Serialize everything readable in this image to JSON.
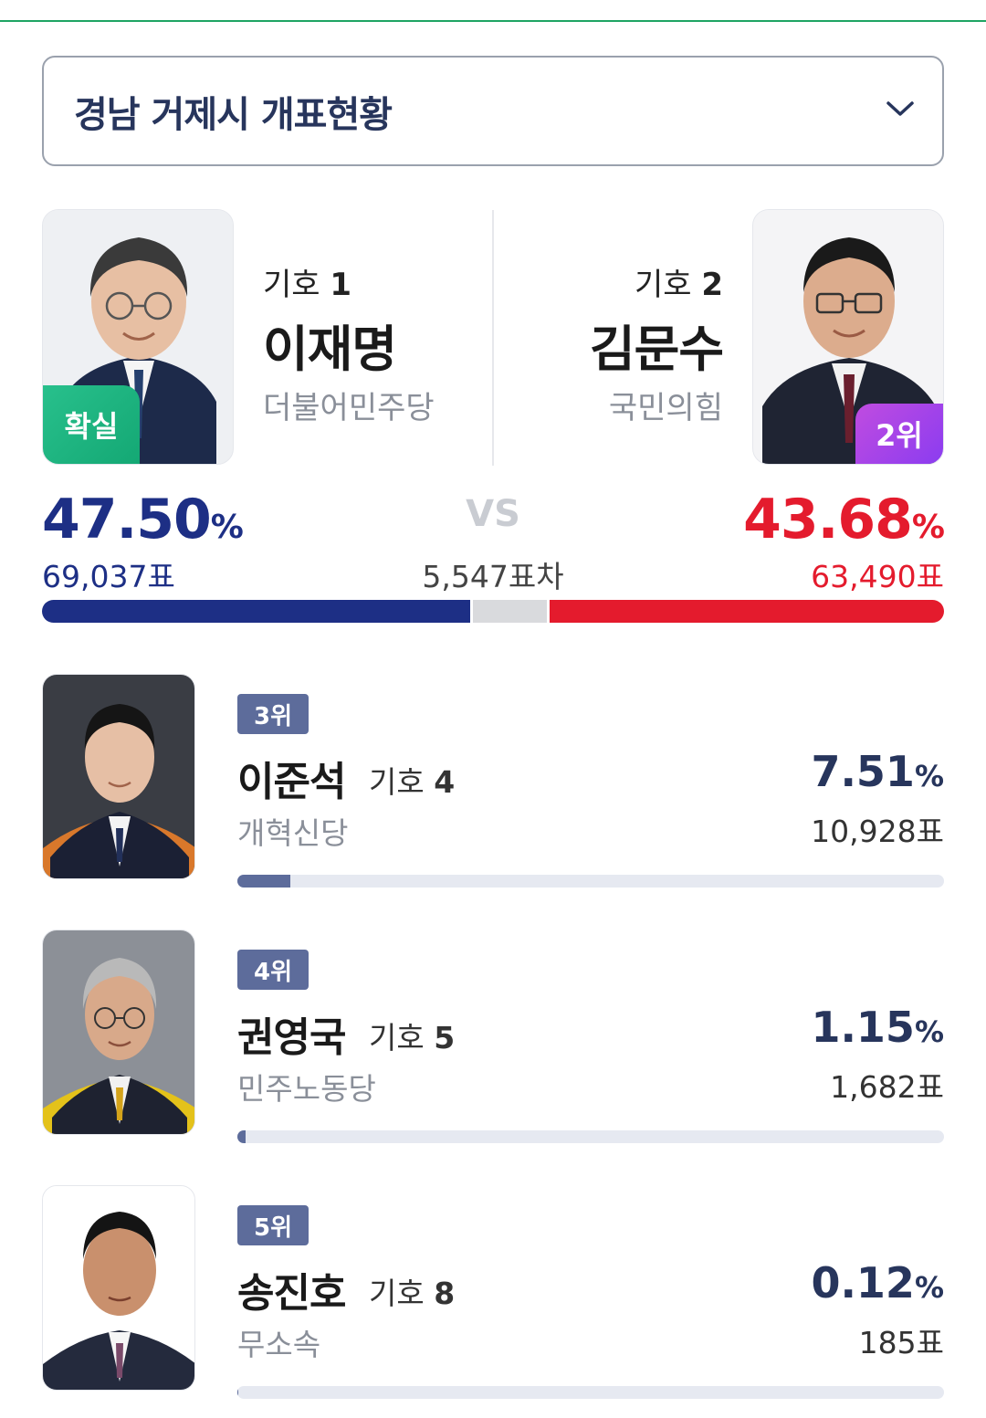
{
  "region": {
    "title": "경남 거제시 개표현황"
  },
  "top_two": {
    "left": {
      "number_label": "기호",
      "number": "1",
      "name": "이재명",
      "party": "더불어민주당",
      "badge": "확실",
      "percent": "47.50",
      "percent_unit": "%",
      "votes": "69,037표",
      "share": 47.5,
      "color": "#1d2f85"
    },
    "right": {
      "number_label": "기호",
      "number": "2",
      "name": "김문수",
      "party": "국민의힘",
      "badge": "2위",
      "percent": "43.68",
      "percent_unit": "%",
      "votes": "63,490표",
      "share": 43.68,
      "color": "#e41b2d"
    },
    "vs": "VS",
    "gap": "5,547표차"
  },
  "others": [
    {
      "rank": "3위",
      "name": "이준석",
      "number_label": "기호",
      "number": "4",
      "party": "개혁신당",
      "percent": "7.51",
      "percent_unit": "%",
      "votes": "10,928표",
      "share": 7.51
    },
    {
      "rank": "4위",
      "name": "권영국",
      "number_label": "기호",
      "number": "5",
      "party": "민주노동당",
      "percent": "1.15",
      "percent_unit": "%",
      "votes": "1,682표",
      "share": 1.15
    },
    {
      "rank": "5위",
      "name": "송진호",
      "number_label": "기호",
      "number": "8",
      "party": "무소속",
      "percent": "0.12",
      "percent_unit": "%",
      "votes": "185표",
      "share": 0.12
    }
  ]
}
